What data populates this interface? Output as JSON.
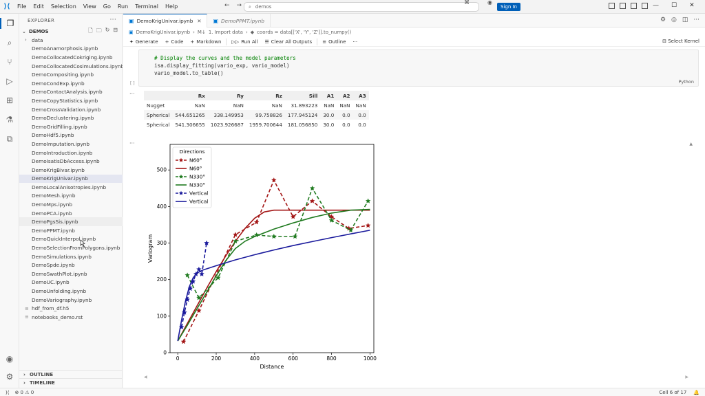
{
  "menu": [
    "File",
    "Edit",
    "Selection",
    "View",
    "Go",
    "Run",
    "Terminal",
    "Help"
  ],
  "search": {
    "value": "demos"
  },
  "signin_label": "Sign In",
  "explorer": {
    "title": "EXPLORER",
    "folder": "DEMOS",
    "items": [
      {
        "label": "data",
        "kind": "folder"
      },
      {
        "label": "DemoAnamorphosis.ipynb",
        "kind": "nb"
      },
      {
        "label": "DemoCollocatedCokriging.ipynb",
        "kind": "nb"
      },
      {
        "label": "DemoCollocatedCosimulations.ipynb",
        "kind": "nb"
      },
      {
        "label": "DemoCompositing.ipynb",
        "kind": "nb"
      },
      {
        "label": "DemoCondExp.ipynb",
        "kind": "nb"
      },
      {
        "label": "DemoContactAnalysis.ipynb",
        "kind": "nb"
      },
      {
        "label": "DemoCopyStatistics.ipynb",
        "kind": "nb"
      },
      {
        "label": "DemoCrossValidation.ipynb",
        "kind": "nb"
      },
      {
        "label": "DemoDeclustering.ipynb",
        "kind": "nb"
      },
      {
        "label": "DemoGridFilling.ipynb",
        "kind": "nb"
      },
      {
        "label": "DemoHdf5.ipynb",
        "kind": "nb"
      },
      {
        "label": "DemoImputation.ipynb",
        "kind": "nb"
      },
      {
        "label": "DemoIntroduction.ipynb",
        "kind": "nb"
      },
      {
        "label": "DemoIsatisDbAccess.ipynb",
        "kind": "nb"
      },
      {
        "label": "DemoKrigBivar.ipynb",
        "kind": "nb"
      },
      {
        "label": "DemoKrigUnivar.ipynb",
        "kind": "nb",
        "selected": true
      },
      {
        "label": "DemoLocalAnisotropies.ipynb",
        "kind": "nb"
      },
      {
        "label": "DemoMesh.ipynb",
        "kind": "nb"
      },
      {
        "label": "DemoMps.ipynb",
        "kind": "nb"
      },
      {
        "label": "DemoPCA.ipynb",
        "kind": "nb"
      },
      {
        "label": "DemoPgsSis.ipynb",
        "kind": "nb",
        "hover": true
      },
      {
        "label": "DemoPPMT.ipynb",
        "kind": "nb"
      },
      {
        "label": "DemoQuickInterpol.ipynb",
        "kind": "nb"
      },
      {
        "label": "DemoSelectionFromPolygons.ipynb",
        "kind": "nb"
      },
      {
        "label": "DemoSimulations.ipynb",
        "kind": "nb"
      },
      {
        "label": "DemoSpde.ipynb",
        "kind": "nb"
      },
      {
        "label": "DemoSwathPlot.ipynb",
        "kind": "nb"
      },
      {
        "label": "DemoUC.ipynb",
        "kind": "nb"
      },
      {
        "label": "DemoUnfolding.ipynb",
        "kind": "nb"
      },
      {
        "label": "DemoVariography.ipynb",
        "kind": "nb"
      },
      {
        "label": "hdf_from_df.h5",
        "kind": "file"
      },
      {
        "label": "notebooks_demo.rst",
        "kind": "file"
      }
    ],
    "outline": "OUTLINE",
    "timeline": "TIMELINE"
  },
  "tabs": [
    {
      "label": "DemoKrigUnivar.ipynb",
      "active": true
    },
    {
      "label": "DemoPPMT.ipynb",
      "active": false
    }
  ],
  "breadcrumb": {
    "file": "DemoKrigUnivar.ipynb",
    "section": "1. Import data",
    "symbol": "coords = data[['X', 'Y', 'Z']].to_numpy()"
  },
  "toolbar": {
    "generate": "Generate",
    "code": "Code",
    "markdown": "Markdown",
    "run_all": "Run All",
    "clear": "Clear All Outputs",
    "outline": "Outline",
    "kernel": "Select Kernel"
  },
  "cell": {
    "lines": [
      {
        "text": "# Display the curves and the model parameters",
        "style": "cm"
      },
      {
        "text": "isa.display_fitting(vario_exp, vario_model)",
        "style": "cd"
      },
      {
        "text": "vario_model.to_table()",
        "style": "cd"
      }
    ],
    "exec": "[ ]",
    "lang": "Python"
  },
  "table": {
    "headers": [
      "",
      "Rx",
      "Ry",
      "Rz",
      "Sill",
      "A1",
      "A2",
      "A3"
    ],
    "rows": [
      [
        "Nugget",
        "NaN",
        "NaN",
        "NaN",
        "31.893223",
        "NaN",
        "NaN",
        "NaN"
      ],
      [
        "Spherical",
        "544.651265",
        "338.149953",
        "99.758826",
        "177.945124",
        "30.0",
        "0.0",
        "0.0"
      ],
      [
        "Spherical",
        "541.306655",
        "1023.926687",
        "1959.700644",
        "181.056850",
        "30.0",
        "0.0",
        "0.0"
      ]
    ]
  },
  "chart_data": {
    "type": "line",
    "xlabel": "Distance",
    "ylabel": "Variogram",
    "xlim": [
      -40,
      1020
    ],
    "ylim": [
      0,
      570
    ],
    "xticks": [
      0,
      200,
      400,
      600,
      800,
      1000
    ],
    "yticks": [
      0,
      100,
      200,
      300,
      400,
      500
    ],
    "legend_title": "Directions",
    "legend_position": "top-left",
    "series": [
      {
        "name": "N60°",
        "kind": "experimental",
        "color": "#a31515",
        "dash": true,
        "x": [
          30,
          110,
          300,
          410,
          500,
          600,
          700,
          800,
          890,
          990
        ],
        "y": [
          30,
          115,
          323,
          357,
          472,
          372,
          415,
          372,
          340,
          348
        ]
      },
      {
        "name": "N60°",
        "kind": "model",
        "color": "#a31515",
        "dash": false,
        "x": [
          0,
          50,
          100,
          150,
          200,
          250,
          300,
          350,
          400,
          450,
          500,
          550,
          600,
          700,
          800,
          900,
          1000
        ],
        "y": [
          32,
          80,
          128,
          176,
          222,
          265,
          305,
          340,
          368,
          385,
          390,
          390,
          390,
          390,
          390,
          390,
          390
        ]
      },
      {
        "name": "N330°",
        "kind": "experimental",
        "color": "#1f7a1f",
        "dash": true,
        "x": [
          50,
          110,
          210,
          300,
          410,
          500,
          610,
          700,
          800,
          900,
          990
        ],
        "y": [
          212,
          150,
          205,
          305,
          322,
          318,
          318,
          450,
          362,
          335,
          415
        ]
      },
      {
        "name": "N330°",
        "kind": "model",
        "color": "#1f7a1f",
        "dash": false,
        "x": [
          0,
          50,
          100,
          150,
          200,
          250,
          300,
          350,
          400,
          500,
          600,
          700,
          800,
          900,
          1000
        ],
        "y": [
          32,
          75,
          120,
          165,
          210,
          252,
          285,
          305,
          318,
          338,
          355,
          370,
          382,
          390,
          392
        ]
      },
      {
        "name": "Vertical",
        "kind": "experimental",
        "color": "#1a1a9c",
        "dash": true,
        "x": [
          20,
          35,
          50,
          65,
          80,
          95,
          110,
          125,
          150
        ],
        "y": [
          70,
          110,
          145,
          175,
          195,
          215,
          228,
          215,
          300
        ]
      },
      {
        "name": "Vertical",
        "kind": "model",
        "color": "#1a1a9c",
        "dash": false,
        "x": [
          0,
          20,
          40,
          60,
          80,
          100,
          130,
          200,
          300,
          400,
          500,
          600,
          700,
          800,
          900,
          1000
        ],
        "y": [
          32,
          90,
          140,
          180,
          205,
          218,
          226,
          238,
          254,
          268,
          281,
          293,
          304,
          315,
          325,
          335
        ]
      }
    ]
  },
  "status": {
    "problems": "⊗ 0  ⚠ 0",
    "cell": "Cell 6 of 17"
  }
}
